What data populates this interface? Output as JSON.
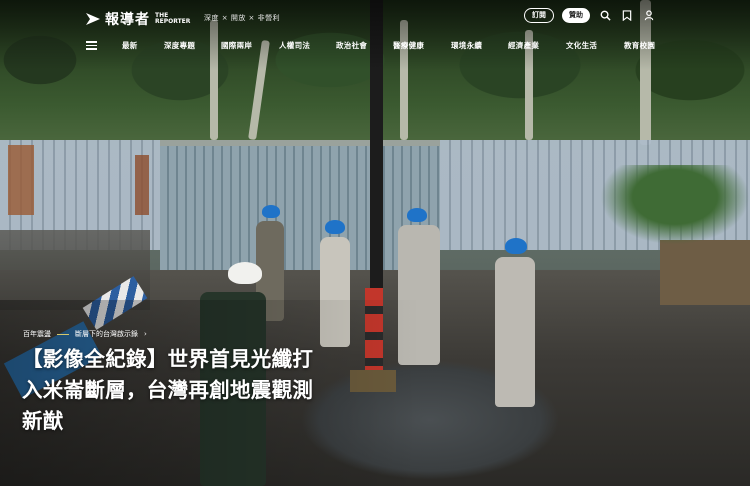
{
  "header": {
    "logo_cn": "報導者",
    "logo_en_line1": "THE",
    "logo_en_line2": "REPORTER",
    "tagline": "深度 × 開放 × 非營利",
    "subscribe_label": "訂閱",
    "donate_label": "贊助",
    "icons": [
      "search-icon",
      "bookmark-icon",
      "user-icon"
    ]
  },
  "nav": {
    "items": [
      "最新",
      "深度專題",
      "國際兩岸",
      "人權司法",
      "政治社會",
      "醫療健康",
      "環境永續",
      "經濟產業",
      "文化生活",
      "教育校園"
    ]
  },
  "article": {
    "tag_primary": "百年震盪",
    "tag_secondary": "斷層下的台灣啟示錄",
    "headline_lines": [
      "【影像全紀錄】世界首見光纖打",
      "入米崙斷層，台灣再創地震觀測",
      "新猷"
    ]
  },
  "colors": {
    "text": "#ffffff",
    "tag_accent": "#d6c76a",
    "donate_bg": "#ffffff"
  }
}
